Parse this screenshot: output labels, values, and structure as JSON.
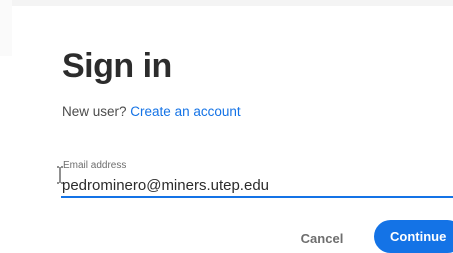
{
  "signin": {
    "title": "Sign in",
    "new_user_prompt": "New user?",
    "create_account_link": "Create an account",
    "email_label": "Email address",
    "email_value": "pedrominero@miners.utep.edu",
    "cancel_label": "Cancel",
    "continue_label": "Continue"
  },
  "colors": {
    "accent": "#1473e6",
    "title": "#2c2c2c",
    "muted": "#6e6e6e"
  },
  "icons": {
    "cursor": "text-cursor-icon"
  }
}
